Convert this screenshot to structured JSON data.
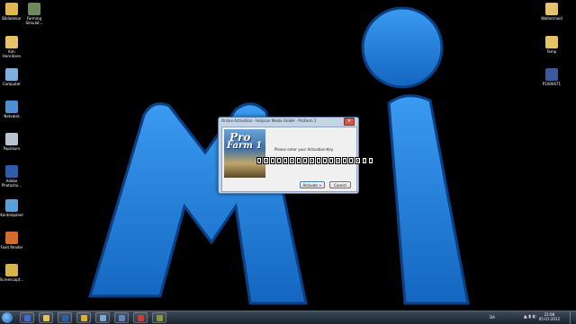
{
  "desktop": {
    "left_icons": [
      {
        "label": "Bibliotekar",
        "icon": "library-icon",
        "color": "#e0b64e"
      },
      {
        "label": "Farming\nSimulat...",
        "icon": "game-shortcut-icon",
        "color": "#6e8a5a"
      },
      {
        "label": "Kim\nHenriksen",
        "icon": "user-folder-icon",
        "color": "#e6c26a"
      },
      {
        "label": "Computer",
        "icon": "computer-icon",
        "color": "#7fb0e0"
      },
      {
        "label": "Netværk",
        "icon": "network-icon",
        "color": "#4f8fd0"
      },
      {
        "label": "Papirkurv",
        "icon": "recycle-bin-icon",
        "color": "#b8c4cc"
      },
      {
        "label": "Adobe\nPhotosho...",
        "icon": "photoshop-icon",
        "color": "#2e5ca8"
      },
      {
        "label": "Kontrolpanel",
        "icon": "control-panel-icon",
        "color": "#5aa0d8"
      },
      {
        "label": "Foxit Reader",
        "icon": "pdf-reader-icon",
        "color": "#d86a2a"
      },
      {
        "label": "Screencapt...",
        "icon": "screencapture-icon",
        "color": "#d8b44e"
      }
    ],
    "right_icons": [
      {
        "label": "Waltercheid",
        "icon": "folder-icon",
        "color": "#e6c26a"
      },
      {
        "label": "Temp",
        "icon": "folder-icon",
        "color": "#e6c26a"
      },
      {
        "label": "P1000671",
        "icon": "image-file-icon",
        "color": "#3a5a9a"
      }
    ]
  },
  "dialog": {
    "title": "Online Activation - Halycon Media GmbH - ProFarm 1",
    "close_symbol": "✕",
    "logo_line1": "Pro",
    "logo_line2": "Farm 1",
    "prompt": "Please enter your Activation-Key",
    "key_cells": 18,
    "activate_label": "Activate >",
    "cancel_label": "Cancel"
  },
  "taskbar": {
    "apps": [
      {
        "icon": "app-b-icon",
        "color": "#3b6fd6"
      },
      {
        "icon": "file-explorer-icon",
        "color": "#e8c25a"
      },
      {
        "icon": "media-player-icon",
        "color": "#2a5ea8"
      },
      {
        "icon": "chrome-icon",
        "color": "#e0b030"
      },
      {
        "icon": "explorer-window-icon",
        "color": "#7aa8d8"
      },
      {
        "icon": "media-center-icon",
        "color": "#5e86c0"
      },
      {
        "icon": "red-app-icon",
        "color": "#d23a3a"
      },
      {
        "icon": "farming-game-icon",
        "color": "#8a9a3a"
      }
    ],
    "language": "DA",
    "time": "21:08",
    "date": "05-01-2012"
  },
  "colors": {
    "logo_blue": "#1f7fd4",
    "logo_highlight": "#5ab2ff"
  }
}
